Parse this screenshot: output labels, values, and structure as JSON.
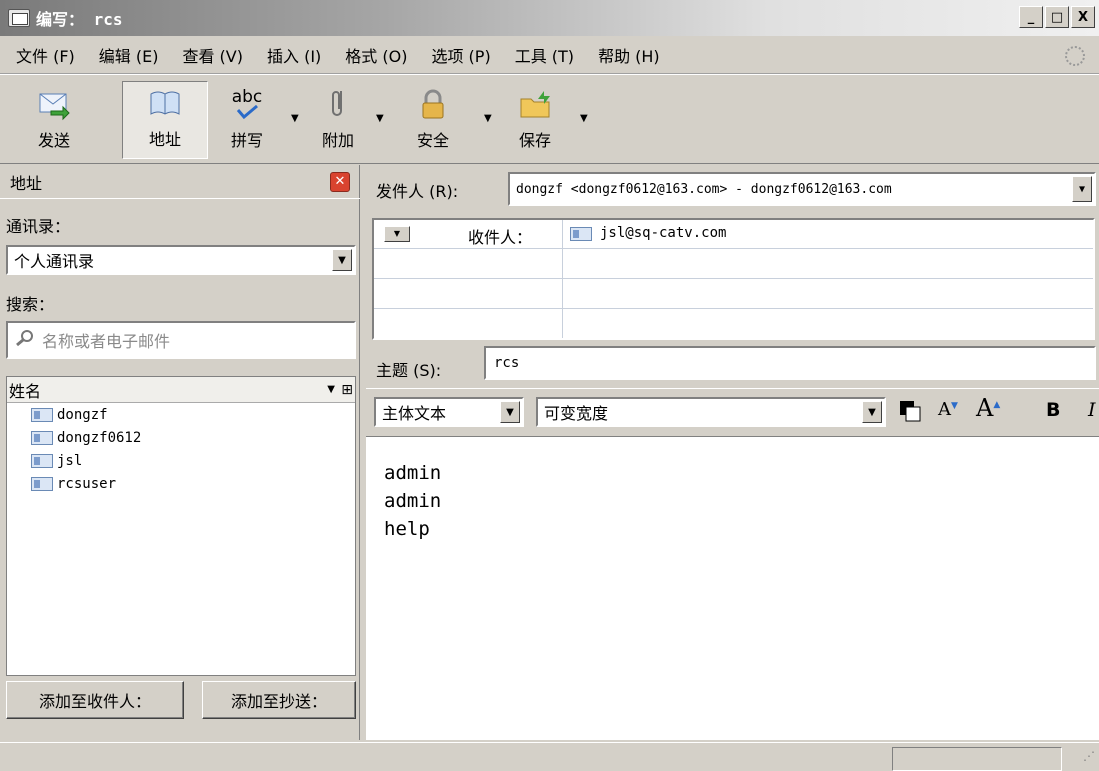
{
  "window": {
    "title": "编写： rcs",
    "buttons": [
      "_",
      "□",
      "X"
    ]
  },
  "menu": {
    "items": [
      "文件 (F)",
      "编辑 (E)",
      "查看 (V)",
      "插入 (I)",
      "格式 (O)",
      "选项 (P)",
      "工具 (T)",
      "帮助 (H)"
    ]
  },
  "toolbar": {
    "send": "发送",
    "address": "地址",
    "spell": "拼写",
    "spell_icon_text": "abc",
    "attach": "附加",
    "security": "安全",
    "save": "保存"
  },
  "address_pane": {
    "title": "地址",
    "book_label": "通讯录：",
    "book_value": "个人通讯录",
    "search_label": "搜索：",
    "search_placeholder": "名称或者电子邮件",
    "column_header": "姓名",
    "contacts": [
      "dongzf",
      "dongzf0612",
      "jsl",
      "rcsuser"
    ],
    "add_to_button": "添加至收件人：",
    "add_cc_button": "添加至抄送："
  },
  "compose": {
    "from_label": "发件人 (R):",
    "from_value": "dongzf <dongzf0612@163.com> - dongzf0612@163.com",
    "recipient_type": "收件人：",
    "recipient_value": "jsl@sq-catv.com",
    "subject_label": "主题 (S):",
    "subject_value": "rcs",
    "format_style": "主体文本",
    "format_font": "可变宽度",
    "bold_label": "B",
    "italic_label": "I",
    "body_lines": [
      "admin",
      "admin",
      "help"
    ]
  }
}
